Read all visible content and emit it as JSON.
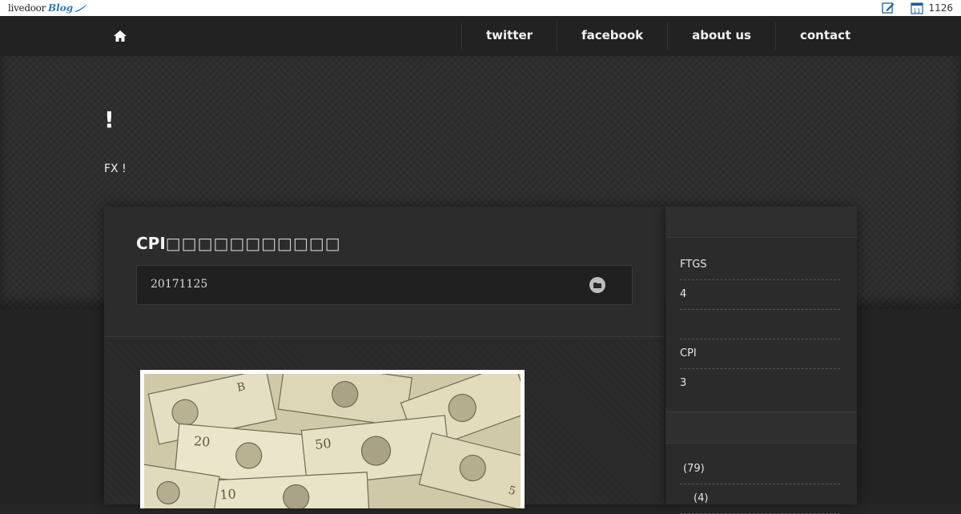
{
  "livedoor_bar": {
    "logo_text": "livedoor",
    "logo_blog": "Blog",
    "visitor_count": "1126",
    "calendar_day": "11"
  },
  "nav": {
    "home_icon": "home-icon",
    "links": [
      "twitter",
      "facebook",
      "about us",
      "contact"
    ]
  },
  "site": {
    "title": "!",
    "description": "FX !"
  },
  "post": {
    "title": "CPI",
    "date": "20171125",
    "category_icon": "folder-icon"
  },
  "sidebar": {
    "section1": [
      "FTGS",
      "4",
      "",
      "CPI",
      "3"
    ],
    "section2": [
      "(79)",
      "(4)"
    ]
  },
  "colors": {
    "background": "#262626",
    "nav": "#222222",
    "accent_blog": "#2a7ac0"
  }
}
